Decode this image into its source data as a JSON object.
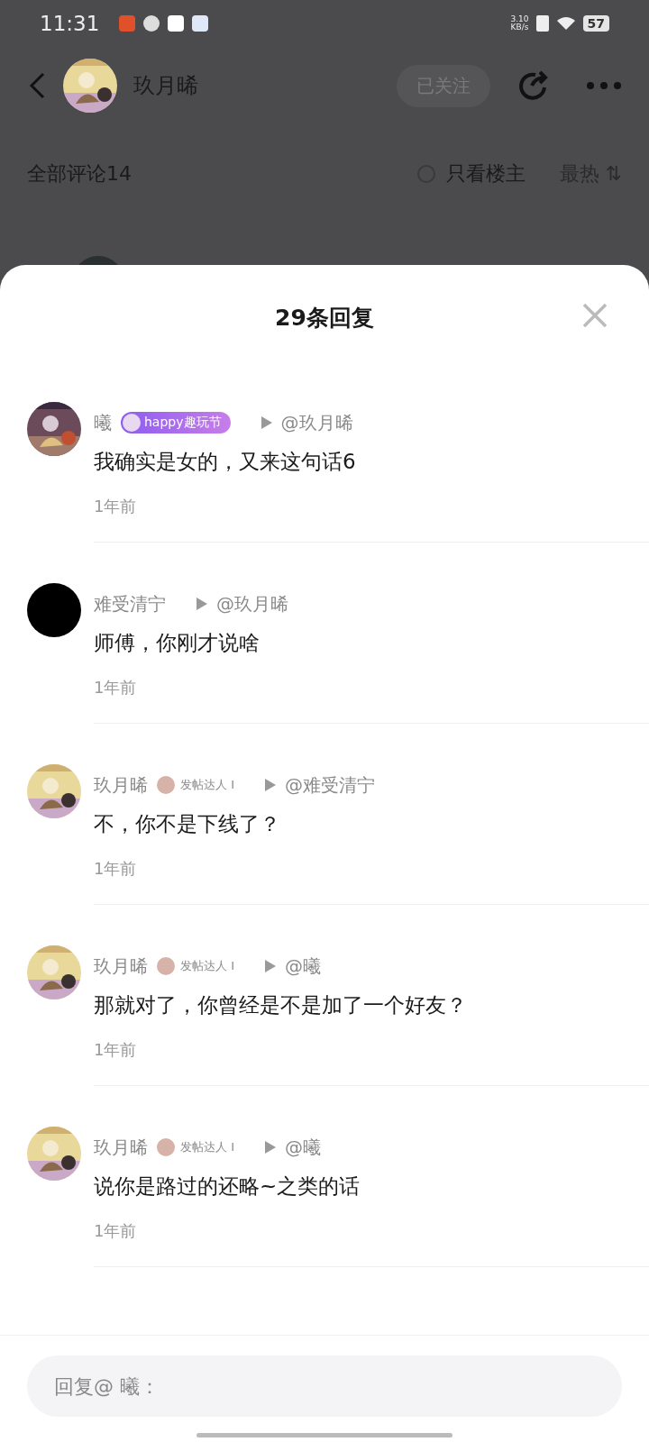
{
  "status_bar": {
    "time": "11:31",
    "net_speed": "3.10",
    "net_unit": "KB/s",
    "battery": "57"
  },
  "header": {
    "user_name": "玖月晞",
    "follow_button": "已关注"
  },
  "comments_bar": {
    "title": "全部评论14",
    "only_op": {
      "label": "只看楼主",
      "checked": false
    },
    "sort": "最热",
    "sort_icon": "⇅"
  },
  "sheet": {
    "title": "29条回复",
    "replies": [
      {
        "name": "曦",
        "badge": {
          "kind": "event",
          "label": "happy趣玩节"
        },
        "target": "@玖月晞",
        "text": "我确实是女的，又来这句话6",
        "time": "1年前"
      },
      {
        "avatar": {
          "kind": "plain"
        },
        "name": "难受清宁",
        "target": "@玖月晞",
        "text": "师傅，你刚才说啥",
        "time": "1年前"
      },
      {
        "name": "玖月晞",
        "badge": {
          "kind": "title",
          "label": "发帖达人 I"
        },
        "target": "@难受清宁",
        "text": "不，你不是下线了？",
        "time": "1年前"
      },
      {
        "name": "玖月晞",
        "badge": {
          "kind": "title",
          "label": "发帖达人 I"
        },
        "target": "@曦",
        "text": "那就对了，你曾经是不是加了一个好友？",
        "time": "1年前"
      },
      {
        "name": "玖月晞",
        "badge": {
          "kind": "title",
          "label": "发帖达人 I"
        },
        "target": "@曦",
        "text": "说你是路过的还略~之类的话",
        "time": "1年前"
      }
    ],
    "reply_field": {
      "placeholder": "回复@ 曦："
    }
  }
}
